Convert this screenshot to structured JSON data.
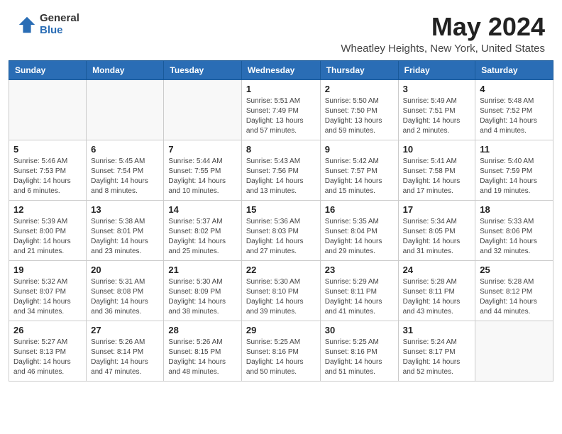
{
  "header": {
    "logo_general": "General",
    "logo_blue": "Blue",
    "month_title": "May 2024",
    "location": "Wheatley Heights, New York, United States"
  },
  "weekdays": [
    "Sunday",
    "Monday",
    "Tuesday",
    "Wednesday",
    "Thursday",
    "Friday",
    "Saturday"
  ],
  "weeks": [
    [
      {
        "day": "",
        "sunrise": "",
        "sunset": "",
        "daylight": ""
      },
      {
        "day": "",
        "sunrise": "",
        "sunset": "",
        "daylight": ""
      },
      {
        "day": "",
        "sunrise": "",
        "sunset": "",
        "daylight": ""
      },
      {
        "day": "1",
        "sunrise": "Sunrise: 5:51 AM",
        "sunset": "Sunset: 7:49 PM",
        "daylight": "Daylight: 13 hours and 57 minutes."
      },
      {
        "day": "2",
        "sunrise": "Sunrise: 5:50 AM",
        "sunset": "Sunset: 7:50 PM",
        "daylight": "Daylight: 13 hours and 59 minutes."
      },
      {
        "day": "3",
        "sunrise": "Sunrise: 5:49 AM",
        "sunset": "Sunset: 7:51 PM",
        "daylight": "Daylight: 14 hours and 2 minutes."
      },
      {
        "day": "4",
        "sunrise": "Sunrise: 5:48 AM",
        "sunset": "Sunset: 7:52 PM",
        "daylight": "Daylight: 14 hours and 4 minutes."
      }
    ],
    [
      {
        "day": "5",
        "sunrise": "Sunrise: 5:46 AM",
        "sunset": "Sunset: 7:53 PM",
        "daylight": "Daylight: 14 hours and 6 minutes."
      },
      {
        "day": "6",
        "sunrise": "Sunrise: 5:45 AM",
        "sunset": "Sunset: 7:54 PM",
        "daylight": "Daylight: 14 hours and 8 minutes."
      },
      {
        "day": "7",
        "sunrise": "Sunrise: 5:44 AM",
        "sunset": "Sunset: 7:55 PM",
        "daylight": "Daylight: 14 hours and 10 minutes."
      },
      {
        "day": "8",
        "sunrise": "Sunrise: 5:43 AM",
        "sunset": "Sunset: 7:56 PM",
        "daylight": "Daylight: 14 hours and 13 minutes."
      },
      {
        "day": "9",
        "sunrise": "Sunrise: 5:42 AM",
        "sunset": "Sunset: 7:57 PM",
        "daylight": "Daylight: 14 hours and 15 minutes."
      },
      {
        "day": "10",
        "sunrise": "Sunrise: 5:41 AM",
        "sunset": "Sunset: 7:58 PM",
        "daylight": "Daylight: 14 hours and 17 minutes."
      },
      {
        "day": "11",
        "sunrise": "Sunrise: 5:40 AM",
        "sunset": "Sunset: 7:59 PM",
        "daylight": "Daylight: 14 hours and 19 minutes."
      }
    ],
    [
      {
        "day": "12",
        "sunrise": "Sunrise: 5:39 AM",
        "sunset": "Sunset: 8:00 PM",
        "daylight": "Daylight: 14 hours and 21 minutes."
      },
      {
        "day": "13",
        "sunrise": "Sunrise: 5:38 AM",
        "sunset": "Sunset: 8:01 PM",
        "daylight": "Daylight: 14 hours and 23 minutes."
      },
      {
        "day": "14",
        "sunrise": "Sunrise: 5:37 AM",
        "sunset": "Sunset: 8:02 PM",
        "daylight": "Daylight: 14 hours and 25 minutes."
      },
      {
        "day": "15",
        "sunrise": "Sunrise: 5:36 AM",
        "sunset": "Sunset: 8:03 PM",
        "daylight": "Daylight: 14 hours and 27 minutes."
      },
      {
        "day": "16",
        "sunrise": "Sunrise: 5:35 AM",
        "sunset": "Sunset: 8:04 PM",
        "daylight": "Daylight: 14 hours and 29 minutes."
      },
      {
        "day": "17",
        "sunrise": "Sunrise: 5:34 AM",
        "sunset": "Sunset: 8:05 PM",
        "daylight": "Daylight: 14 hours and 31 minutes."
      },
      {
        "day": "18",
        "sunrise": "Sunrise: 5:33 AM",
        "sunset": "Sunset: 8:06 PM",
        "daylight": "Daylight: 14 hours and 32 minutes."
      }
    ],
    [
      {
        "day": "19",
        "sunrise": "Sunrise: 5:32 AM",
        "sunset": "Sunset: 8:07 PM",
        "daylight": "Daylight: 14 hours and 34 minutes."
      },
      {
        "day": "20",
        "sunrise": "Sunrise: 5:31 AM",
        "sunset": "Sunset: 8:08 PM",
        "daylight": "Daylight: 14 hours and 36 minutes."
      },
      {
        "day": "21",
        "sunrise": "Sunrise: 5:30 AM",
        "sunset": "Sunset: 8:09 PM",
        "daylight": "Daylight: 14 hours and 38 minutes."
      },
      {
        "day": "22",
        "sunrise": "Sunrise: 5:30 AM",
        "sunset": "Sunset: 8:10 PM",
        "daylight": "Daylight: 14 hours and 39 minutes."
      },
      {
        "day": "23",
        "sunrise": "Sunrise: 5:29 AM",
        "sunset": "Sunset: 8:11 PM",
        "daylight": "Daylight: 14 hours and 41 minutes."
      },
      {
        "day": "24",
        "sunrise": "Sunrise: 5:28 AM",
        "sunset": "Sunset: 8:11 PM",
        "daylight": "Daylight: 14 hours and 43 minutes."
      },
      {
        "day": "25",
        "sunrise": "Sunrise: 5:28 AM",
        "sunset": "Sunset: 8:12 PM",
        "daylight": "Daylight: 14 hours and 44 minutes."
      }
    ],
    [
      {
        "day": "26",
        "sunrise": "Sunrise: 5:27 AM",
        "sunset": "Sunset: 8:13 PM",
        "daylight": "Daylight: 14 hours and 46 minutes."
      },
      {
        "day": "27",
        "sunrise": "Sunrise: 5:26 AM",
        "sunset": "Sunset: 8:14 PM",
        "daylight": "Daylight: 14 hours and 47 minutes."
      },
      {
        "day": "28",
        "sunrise": "Sunrise: 5:26 AM",
        "sunset": "Sunset: 8:15 PM",
        "daylight": "Daylight: 14 hours and 48 minutes."
      },
      {
        "day": "29",
        "sunrise": "Sunrise: 5:25 AM",
        "sunset": "Sunset: 8:16 PM",
        "daylight": "Daylight: 14 hours and 50 minutes."
      },
      {
        "day": "30",
        "sunrise": "Sunrise: 5:25 AM",
        "sunset": "Sunset: 8:16 PM",
        "daylight": "Daylight: 14 hours and 51 minutes."
      },
      {
        "day": "31",
        "sunrise": "Sunrise: 5:24 AM",
        "sunset": "Sunset: 8:17 PM",
        "daylight": "Daylight: 14 hours and 52 minutes."
      },
      {
        "day": "",
        "sunrise": "",
        "sunset": "",
        "daylight": ""
      }
    ]
  ]
}
